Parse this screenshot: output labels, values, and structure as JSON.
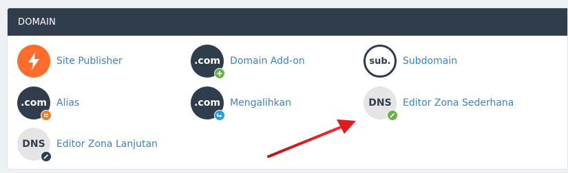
{
  "panel": {
    "title": "DOMAIN"
  },
  "items": [
    {
      "label": "Site Publisher",
      "icon": "lightning-bolt-icon"
    },
    {
      "label": "Domain Add-on",
      "icon": "dotcom-icon",
      "icon_text": ".com",
      "badge": "plus-icon"
    },
    {
      "label": "Subdomain",
      "icon": "subdomain-icon",
      "icon_text": "sub."
    },
    {
      "label": "Alias",
      "icon": "dotcom-icon",
      "icon_text": ".com",
      "badge": "equals-icon"
    },
    {
      "label": "Mengalihkan",
      "icon": "dotcom-icon",
      "icon_text": ".com",
      "badge": "redirect-icon"
    },
    {
      "label": "Editor Zona Sederhana",
      "icon": "dns-icon",
      "icon_text": "DNS",
      "badge": "pencil-icon"
    },
    {
      "label": "Editor Zona Lanjutan",
      "icon": "dns-icon",
      "icon_text": "DNS",
      "badge": "pencil-icon"
    }
  ],
  "colors": {
    "header_bg": "#2f3d4d",
    "link": "#3b82c4",
    "orange": "#ff6c2c",
    "badge_green": "#6ab04c",
    "badge_orange": "#f07d2e",
    "badge_blue": "#2a9fd6",
    "badge_dark": "#2f3d4d",
    "annotation_arrow": "#e01b1b"
  }
}
